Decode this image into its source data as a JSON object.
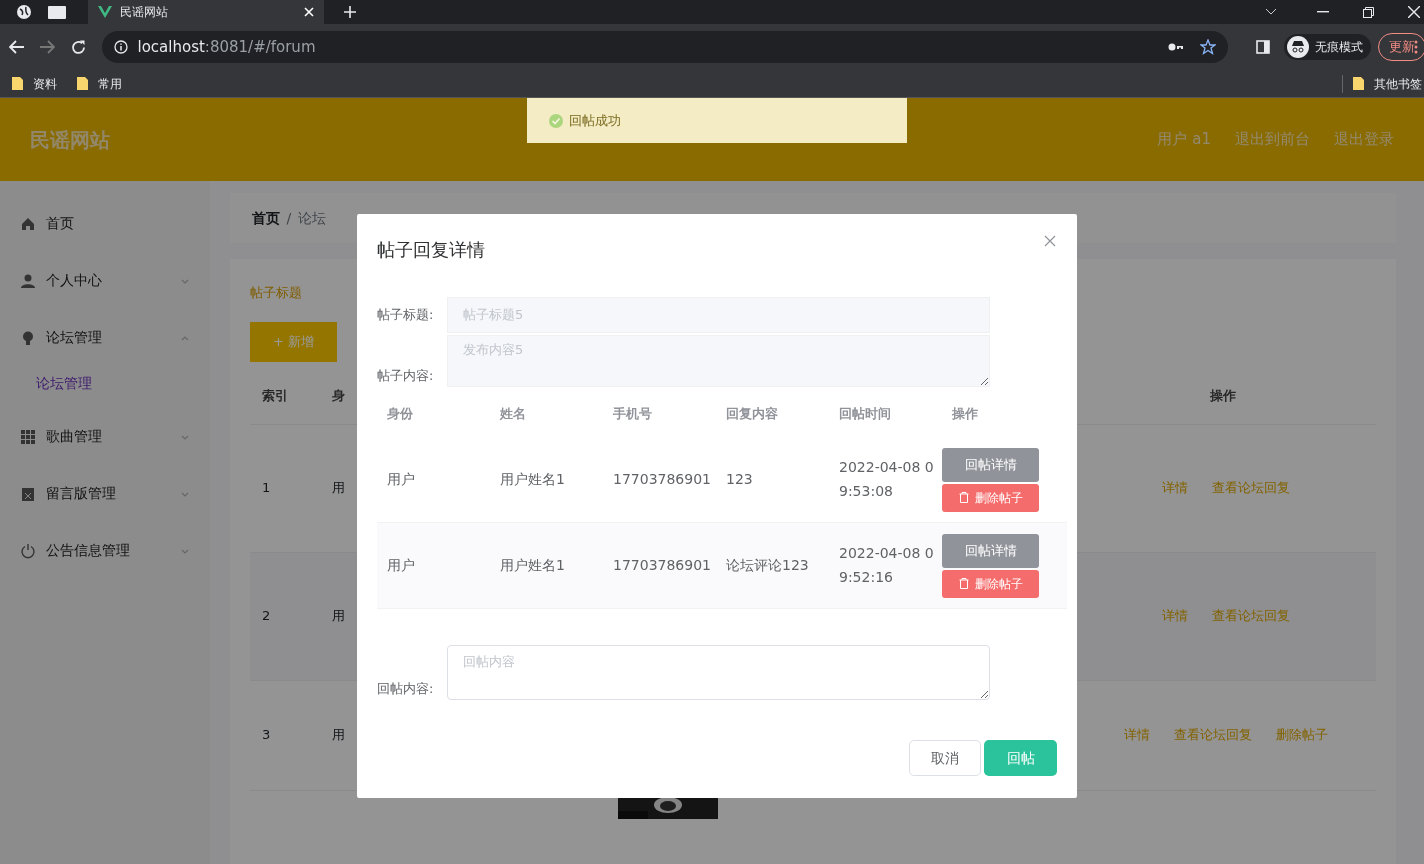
{
  "browser": {
    "tabs": [
      {
        "title": "民谣网站",
        "selected": true
      }
    ],
    "url": {
      "host": "localhost",
      "path": ":8081/#/forum"
    },
    "profile_label": "无痕模式",
    "update_button": "更新",
    "bookmarks": [
      "资料",
      "常用"
    ],
    "other_bookmarks": "其他书签"
  },
  "app": {
    "site_title": "民谣网站",
    "toast": {
      "text": "回帖成功"
    },
    "header_links": [
      "用户 a1",
      "退出到前台",
      "退出登录"
    ],
    "sidebar": {
      "items": [
        {
          "label": "首页"
        },
        {
          "label": "个人中心",
          "expanded": false
        },
        {
          "label": "论坛管理",
          "expanded": true,
          "children": [
            {
              "label": "论坛管理",
              "selected": true
            }
          ]
        },
        {
          "label": "歌曲管理",
          "expanded": false
        },
        {
          "label": "留言版管理",
          "expanded": false
        },
        {
          "label": "公告信息管理",
          "expanded": false
        }
      ]
    },
    "breadcrumb": {
      "items": [
        "首页",
        "论坛"
      ],
      "separator": "/"
    },
    "search_label": "帖子标题",
    "add_button": "+ 新增",
    "table": {
      "columns": [
        "索引",
        "身",
        "操作"
      ],
      "rows": [
        {
          "index": "1",
          "column_2": "用",
          "actions": [
            "详情",
            "查看论坛回复"
          ]
        },
        {
          "index": "2",
          "column_2": "用",
          "actions": [
            "详情",
            "查看论坛回复"
          ]
        },
        {
          "index": "3",
          "column_2": "用",
          "actions": [
            "详情",
            "查看论坛回复",
            "删除帖子"
          ]
        }
      ]
    }
  },
  "dialog": {
    "title": "帖子回复详情",
    "fields": [
      {
        "label": "帖子标题:",
        "value": "帖子标题5",
        "kind": "input"
      },
      {
        "label": "帖子内容:",
        "value": "发布内容5",
        "kind": "textarea"
      }
    ],
    "table": {
      "columns": [
        "身份",
        "姓名",
        "手机号",
        "回复内容",
        "回帖时间",
        "操作"
      ],
      "rows": [
        {
          "cells": [
            "用户",
            "用户姓名1",
            "17703786901",
            "123",
            "2022-04-08 09:53:08"
          ],
          "actions": [
            "回帖详情",
            "删除帖子"
          ]
        },
        {
          "cells": [
            "用户",
            "用户姓名1",
            "17703786901",
            "论坛评论123",
            "2022-04-08 09:52:16"
          ],
          "actions": [
            "回帖详情",
            "删除帖子"
          ]
        }
      ]
    },
    "reply": {
      "label": "回帖内容:",
      "placeholder": "回帖内容"
    },
    "buttons": [
      {
        "label": "取消",
        "kind": "default"
      },
      {
        "label": "回帖",
        "kind": "primary"
      }
    ]
  }
}
